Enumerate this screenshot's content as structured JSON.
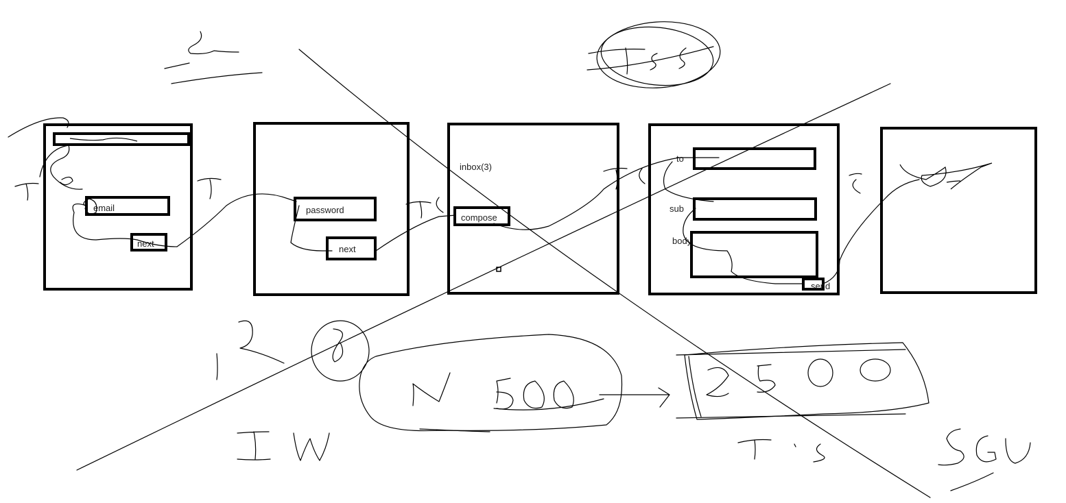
{
  "frames": [
    {
      "name": "email-screen",
      "elements": {
        "email_field": "email",
        "next_button": "next"
      }
    },
    {
      "name": "password-screen",
      "elements": {
        "password_field": "password",
        "next_button": "next"
      }
    },
    {
      "name": "inbox-screen",
      "elements": {
        "inbox_label": "inbox(3)",
        "compose_button": "compose"
      }
    },
    {
      "name": "compose-screen",
      "elements": {
        "to_label": "to",
        "sub_label": "sub",
        "body_label": "body",
        "send_button": "send"
      }
    },
    {
      "name": "sent-screen",
      "elements": {}
    }
  ],
  "colors": {
    "stroke": "#000000",
    "background": "#ffffff"
  }
}
